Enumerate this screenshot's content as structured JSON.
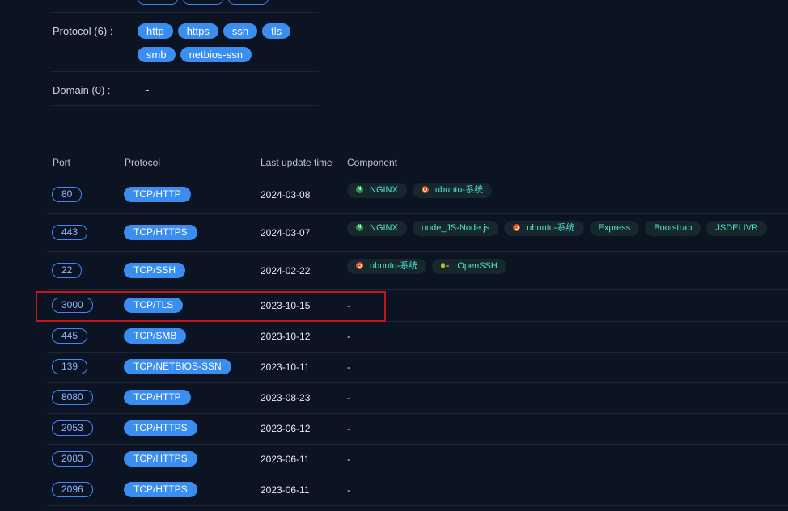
{
  "info": {
    "protocol_label": "Protocol  (6)  :",
    "protocols_row1": [
      "http",
      "https",
      "ssh",
      "tls"
    ],
    "protocols_row2": [
      "smb",
      "netbios-ssn"
    ],
    "domain_label": "Domain  (0)  :",
    "domain_value": "-"
  },
  "table": {
    "headers": {
      "port": "Port",
      "protocol": "Protocol",
      "last_update": "Last update time",
      "component": "Component"
    },
    "rows": [
      {
        "port": "80",
        "protocol": "TCP/HTTP",
        "date": "2024-03-08",
        "components": [
          {
            "icon": "nginx-icon",
            "label": "NGINX"
          },
          {
            "icon": "ubuntu-icon",
            "label": "ubuntu-系统"
          }
        ]
      },
      {
        "port": "443",
        "protocol": "TCP/HTTPS",
        "date": "2024-03-07",
        "components": [
          {
            "icon": "nginx-icon",
            "label": "NGINX"
          },
          {
            "icon": "",
            "label": "node_JS-Node.js"
          },
          {
            "icon": "ubuntu-icon",
            "label": "ubuntu-系统"
          },
          {
            "icon": "",
            "label": "Express"
          },
          {
            "icon": "",
            "label": "Bootstrap"
          },
          {
            "icon": "",
            "label": "JSDELIVR"
          }
        ]
      },
      {
        "port": "22",
        "protocol": "TCP/SSH",
        "date": "2024-02-22",
        "components": [
          {
            "icon": "ubuntu-icon",
            "label": "ubuntu-系统"
          },
          {
            "icon": "openssh-icon",
            "label": "OpenSSH"
          }
        ]
      },
      {
        "port": "3000",
        "protocol": "TCP/TLS",
        "date": "2023-10-15",
        "components": [],
        "empty": "-"
      },
      {
        "port": "445",
        "protocol": "TCP/SMB",
        "date": "2023-10-12",
        "components": [],
        "empty": "-"
      },
      {
        "port": "139",
        "protocol": "TCP/NETBIOS-SSN",
        "date": "2023-10-11",
        "components": [],
        "empty": "-"
      },
      {
        "port": "8080",
        "protocol": "TCP/HTTP",
        "date": "2023-08-23",
        "components": [],
        "empty": "-"
      },
      {
        "port": "2053",
        "protocol": "TCP/HTTPS",
        "date": "2023-06-12",
        "components": [],
        "empty": "-"
      },
      {
        "port": "2083",
        "protocol": "TCP/HTTPS",
        "date": "2023-06-11",
        "components": [],
        "empty": "-"
      },
      {
        "port": "2096",
        "protocol": "TCP/HTTPS",
        "date": "2023-06-11",
        "components": [],
        "empty": "-"
      }
    ]
  },
  "colors": {
    "background": "#0c1423",
    "accent": "#3a8ef0",
    "component_text": "#4fe0d0",
    "highlight": "#c4161c"
  }
}
